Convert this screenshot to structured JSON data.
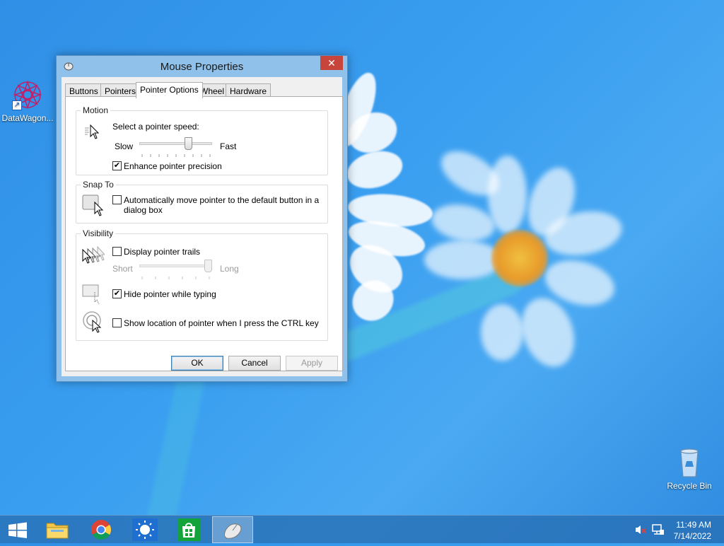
{
  "desktop": {
    "icons": [
      {
        "label": "DataWagon..."
      },
      {
        "label": "Recycle Bin"
      }
    ]
  },
  "window": {
    "title": "Mouse Properties",
    "close_glyph": "✕",
    "tabs": [
      {
        "label": "Buttons"
      },
      {
        "label": "Pointers"
      },
      {
        "label": "Pointer Options"
      },
      {
        "label": "Wheel"
      },
      {
        "label": "Hardware"
      }
    ],
    "active_tab": "Pointer Options",
    "motion": {
      "title": "Motion",
      "speed_label": "Select a pointer speed:",
      "slow": "Slow",
      "fast": "Fast",
      "speed_value": 0.6,
      "precision_label": "Enhance pointer precision",
      "precision_checked": true
    },
    "snap_to": {
      "title": "Snap To",
      "auto_move_label": "Automatically move pointer to the default button in a dialog box",
      "auto_move_line1": "Automatically move pointer to the default button in a",
      "auto_move_line2": "dialog box",
      "auto_move_checked": false
    },
    "visibility": {
      "title": "Visibility",
      "trails_label": "Display pointer trails",
      "trails_checked": false,
      "short": "Short",
      "long": "Long",
      "trail_length_value": 1.0,
      "hide_label": "Hide pointer while typing",
      "hide_checked": true,
      "ctrl_label": "Show location of pointer when I press the CTRL key",
      "ctrl_checked": false
    },
    "buttons": {
      "ok": "OK",
      "cancel": "Cancel",
      "apply": "Apply"
    }
  },
  "taskbar": {
    "apps": [
      "file-explorer",
      "chrome",
      "brightness-app",
      "store",
      "mouse-properties"
    ],
    "active_app": "mouse-properties",
    "time": "11:49 AM",
    "date": "7/14/2022"
  },
  "colors": {
    "desktop_blue": "#3a9ff0",
    "window_frame": "#8fc1ea",
    "close_red": "#c7453a",
    "taskbar": "#286eb4"
  }
}
